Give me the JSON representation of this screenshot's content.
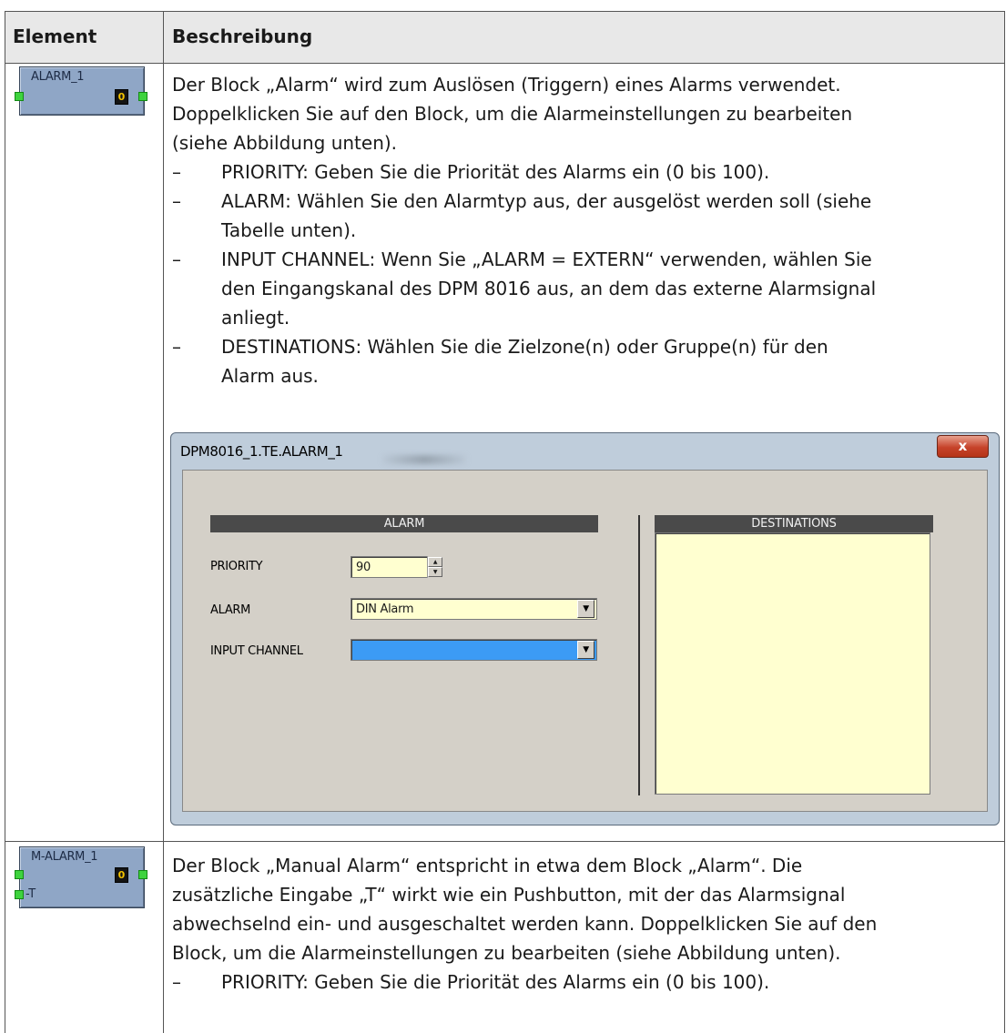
{
  "table": {
    "header": {
      "element": "Element",
      "description": "Beschreibung"
    }
  },
  "row1": {
    "block": {
      "title": "ALARM_1",
      "led": "0"
    },
    "lines": [
      "Der Block „Alarm“ wird zum Auslösen (Triggern) eines Alarms verwendet.",
      "Doppelklicken Sie auf den Block, um die Alarmeinstellungen zu bearbeiten",
      "(siehe Abbildung unten)."
    ],
    "bullets": [
      {
        "dash": "–",
        "lines": [
          "PRIORITY: Geben Sie die Priorität des Alarms ein (0 bis 100)."
        ]
      },
      {
        "dash": "–",
        "lines": [
          "ALARM: Wählen Sie den Alarmtyp aus, der ausgelöst werden soll (siehe",
          "Tabelle unten)."
        ]
      },
      {
        "dash": "–",
        "lines": [
          "INPUT CHANNEL: Wenn Sie „ALARM = EXTERN“ verwenden, wählen Sie",
          "den Eingangskanal des DPM 8016 aus, an dem das externe Alarmsignal",
          "anliegt."
        ]
      },
      {
        "dash": "–",
        "lines": [
          "DESTINATIONS: Wählen Sie die Zielzone(n) oder Gruppe(n) für den",
          "Alarm aus."
        ]
      }
    ]
  },
  "dialog": {
    "title": "DPM8016_1.TE.ALARM_1",
    "close_label": "x",
    "alarm_section": "ALARM",
    "destinations_section": "DESTINATIONS",
    "priority_label": "PRIORITY",
    "priority_value": "90",
    "alarm_label": "ALARM",
    "alarm_value": "DIN Alarm",
    "input_channel_label": "INPUT CHANNEL",
    "input_channel_value": "",
    "dropdown_glyph": "▼",
    "spin_up": "▲",
    "spin_down": "▼",
    "colors": {
      "field_bg": "#ffffd0",
      "selected_bg": "#3c9bf5",
      "section_bar": "#4a4a4a",
      "close_button": "#c6432a"
    }
  },
  "row2": {
    "block": {
      "title": "M-ALARM_1",
      "led": "0",
      "input": "-T"
    },
    "lines": [
      "Der Block „Manual Alarm“ entspricht in etwa dem Block „Alarm“. Die",
      "zusätzliche Eingabe „T“ wirkt wie ein Pushbutton, mit der das Alarmsignal",
      "abwechselnd ein- und ausgeschaltet werden kann. Doppelklicken Sie auf den",
      "Block, um die Alarmeinstellungen zu bearbeiten (siehe Abbildung unten)."
    ],
    "bullets": [
      {
        "dash": "–",
        "lines": [
          "PRIORITY: Geben Sie die Priorität des Alarms ein (0 bis 100)."
        ]
      }
    ]
  }
}
